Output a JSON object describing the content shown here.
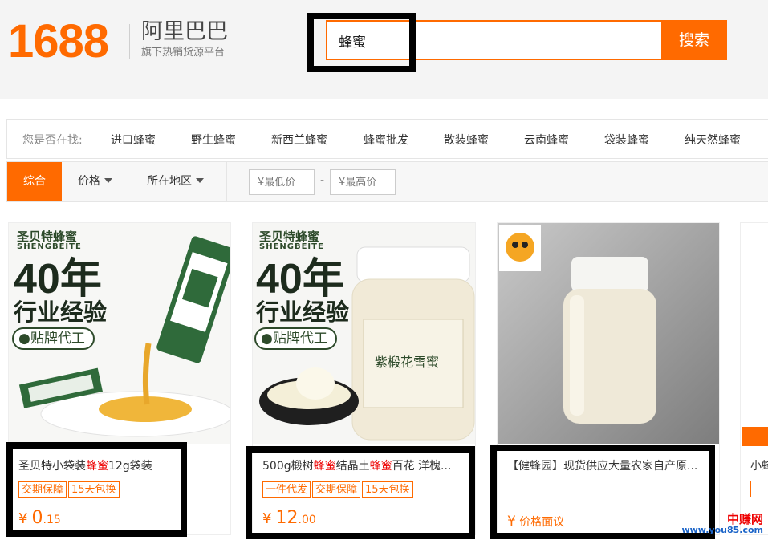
{
  "header": {
    "logo_number": "1688",
    "logo_brand": "阿里巴巴",
    "logo_subtitle": "旗下热销货源平台"
  },
  "search": {
    "value": "蜂蜜",
    "button_label": "搜索"
  },
  "suggest": {
    "label": "您是否在找:",
    "items": [
      "进口蜂蜜",
      "野生蜂蜜",
      "新西兰蜂蜜",
      "蜂蜜批发",
      "散装蜂蜜",
      "云南蜂蜜",
      "袋装蜂蜜",
      "纯天然蜂蜜"
    ]
  },
  "filters": {
    "comprehensive": "综合",
    "price": "价格",
    "region": "所在地区",
    "min_price_placeholder": "¥最低价",
    "separator": "-",
    "max_price_placeholder": "¥最高价"
  },
  "products": [
    {
      "title_prefix": "圣贝特小袋装",
      "title_highlight": "蜂蜜",
      "title_suffix": "12g袋装",
      "tags": [
        "交期保障",
        "15天包换"
      ],
      "price_symbol": "¥",
      "price_int": "0",
      "price_dec": ".15",
      "image": {
        "brand": "圣贝特蜂蜜",
        "brand_en": "SHENGBEITE",
        "big_number": "40年",
        "experience": "行业经验",
        "oem": "●贴牌代工"
      }
    },
    {
      "title_a": "500g椴树",
      "title_b": "蜂蜜",
      "title_c": "结晶土",
      "title_d": "蜂蜜",
      "title_e": "百花 洋槐...",
      "tags": [
        "一件代发",
        "交期保障",
        "15天包换"
      ],
      "price_symbol": "¥",
      "price_int": "12",
      "price_dec": ".00",
      "image": {
        "brand": "圣贝特蜂蜜",
        "brand_en": "SHENGBEITE",
        "big_number": "40年",
        "experience": "行业经验",
        "oem": "●贴牌代工",
        "jar_label": "紫椴花雪蜜"
      }
    },
    {
      "title": "【健蜂园】现货供应大量农家自产原...",
      "price_symbol": "¥",
      "price_text": "价格面议"
    },
    {
      "title": "小蜂"
    }
  ],
  "watermark": {
    "line1": "中赚网",
    "line2": "www.you85.com"
  },
  "colors": {
    "accent": "#ff6a00",
    "highlight": "#ee0000"
  }
}
